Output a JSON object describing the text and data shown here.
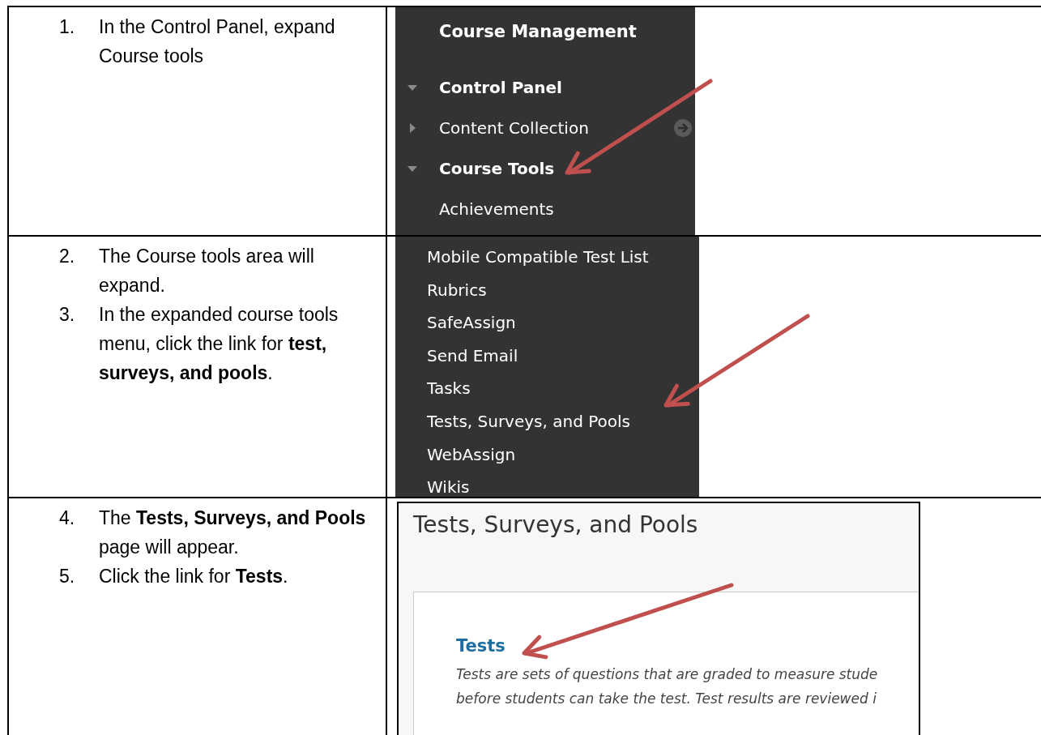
{
  "steps": [
    {
      "items": [
        {
          "number": "1.",
          "text": "In the Control Panel, expand Course tools"
        }
      ],
      "screenshot": {
        "kind": "course_menu",
        "header": "Course Management",
        "entries": [
          {
            "label": "Control Panel",
            "kind": "section",
            "expanded": true
          },
          {
            "label": "Content Collection",
            "kind": "section",
            "expanded": false
          },
          {
            "label": "Course Tools",
            "kind": "section",
            "expanded": true
          },
          {
            "label": "Achievements",
            "kind": "link"
          }
        ]
      }
    },
    {
      "items": [
        {
          "number": "2.",
          "text": "The Course tools area will expand."
        },
        {
          "number": "3.",
          "text": " In the expanded course tools menu, click the link for **test, surveys, and pools**."
        }
      ],
      "screenshot": {
        "kind": "tool_list",
        "entries": [
          "Mobile Compatible Test List",
          "Rubrics",
          "SafeAssign",
          "Send Email",
          "Tasks",
          "Tests, Surveys, and Pools",
          "WebAssign",
          "Wikis"
        ]
      }
    },
    {
      "items": [
        {
          "number": "4.",
          "text": "The **Tests, Surveys, and Pools** page will appear."
        },
        {
          "number": "5.",
          "text": "Click the link for **Tests**."
        }
      ],
      "screenshot": {
        "kind": "page",
        "title": "Tests, Surveys, and Pools",
        "link": "Tests",
        "description": [
          "Tests are sets of questions that are graded to measure stude",
          "before students can take the test. Test results are reviewed i"
        ]
      }
    }
  ]
}
